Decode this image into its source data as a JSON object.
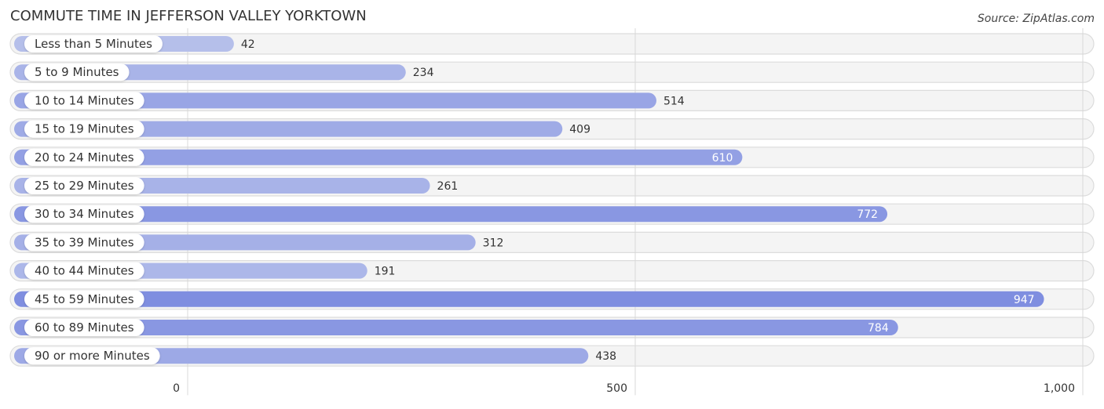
{
  "title": "COMMUTE TIME IN JEFFERSON VALLEY YORKTOWN",
  "source": "Source: ZipAtlas.com",
  "chart_data": {
    "type": "bar",
    "orientation": "horizontal",
    "title": "COMMUTE TIME IN JEFFERSON VALLEY YORKTOWN",
    "xlabel": "",
    "ylabel": "",
    "xlim": [
      0,
      1000
    ],
    "grid": true,
    "ticks": [
      {
        "value": 0,
        "label": "0"
      },
      {
        "value": 500,
        "label": "500"
      },
      {
        "value": 1000,
        "label": "1,000"
      }
    ],
    "categories": [
      "Less than 5 Minutes",
      "5 to 9 Minutes",
      "10 to 14 Minutes",
      "15 to 19 Minutes",
      "20 to 24 Minutes",
      "25 to 29 Minutes",
      "30 to 34 Minutes",
      "35 to 39 Minutes",
      "40 to 44 Minutes",
      "45 to 59 Minutes",
      "60 to 89 Minutes",
      "90 or more Minutes"
    ],
    "values": [
      42,
      234,
      514,
      409,
      610,
      261,
      772,
      312,
      191,
      947,
      784,
      438
    ],
    "colors": {
      "low": "#b7c1eb",
      "high": "#7c8bdf",
      "track": "#f4f4f4",
      "track_border": "#dcdcdc",
      "grid": "#d8d8d8"
    }
  }
}
